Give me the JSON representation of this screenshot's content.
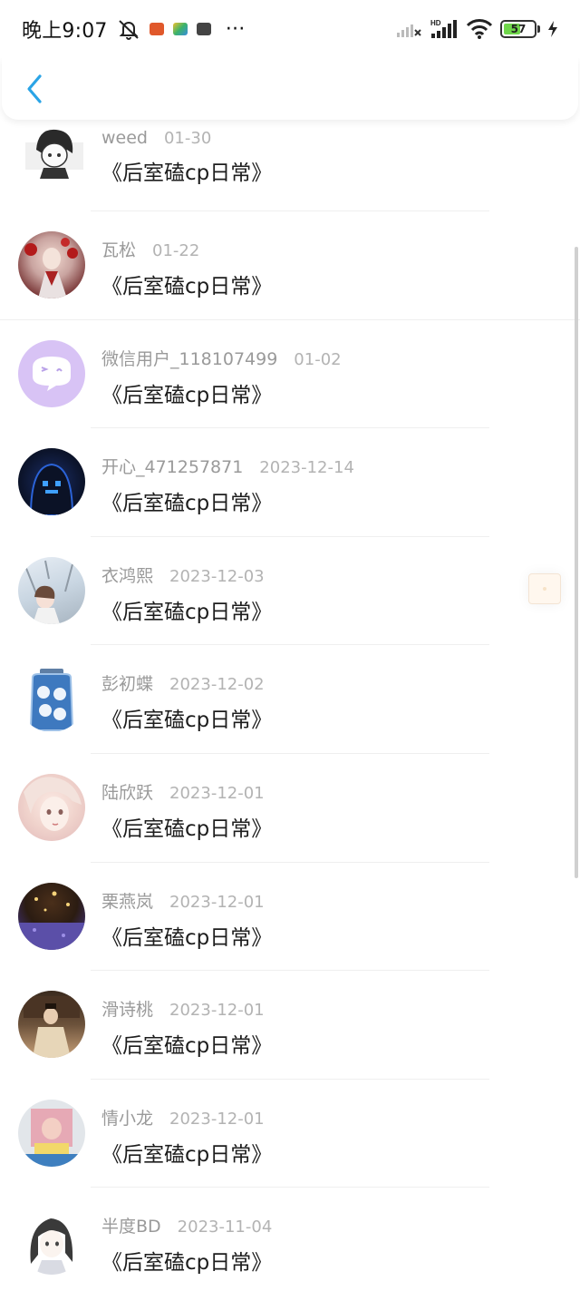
{
  "status_bar": {
    "time": "晚上9:07",
    "battery": "57",
    "battery_level": 0.57,
    "network_label": "HD"
  },
  "header": {
    "back_icon": "chevron-left-icon",
    "accent_color": "#2aa4e6"
  },
  "entries": [
    {
      "name": "weed",
      "date": "01-30",
      "title": "《后室磕cp日常》"
    },
    {
      "name": "瓦松",
      "date": "01-22",
      "title": "《后室磕cp日常》"
    },
    {
      "name": "微信用户_118107499",
      "date": "01-02",
      "title": "《后室磕cp日常》"
    },
    {
      "name": "开心_471257871",
      "date": "2023-12-14",
      "title": "《后室磕cp日常》"
    },
    {
      "name": "衣鸿熙",
      "date": "2023-12-03",
      "title": "《后室磕cp日常》"
    },
    {
      "name": "彭初蝶",
      "date": "2023-12-02",
      "title": "《后室磕cp日常》"
    },
    {
      "name": "陆欣跃",
      "date": "2023-12-01",
      "title": "《后室磕cp日常》"
    },
    {
      "name": "栗燕岚",
      "date": "2023-12-01",
      "title": "《后室磕cp日常》"
    },
    {
      "name": "滑诗桃",
      "date": "2023-12-01",
      "title": "《后室磕cp日常》"
    },
    {
      "name": "情小龙",
      "date": "2023-12-01",
      "title": "《后室磕cp日常》"
    },
    {
      "name": "半度BD",
      "date": "2023-11-04",
      "title": "《后室磕cp日常》"
    }
  ]
}
